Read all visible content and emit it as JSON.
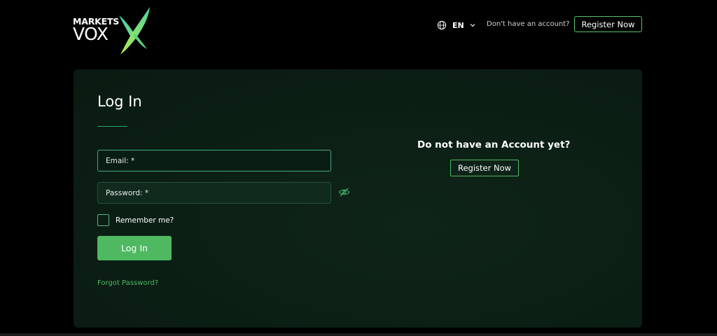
{
  "header": {
    "logo": {
      "line1": "MARKETS",
      "line2": "VOX"
    },
    "language": {
      "code": "EN",
      "icon": "globe-icon"
    },
    "no_account_text": "Don't have an account?",
    "register_label": "Register Now"
  },
  "login": {
    "title": "Log In",
    "email_placeholder": "Email: *",
    "password_placeholder": "Password: *",
    "remember_label": "Remember me?",
    "submit_label": "Log In",
    "forgot_label": "Forgot Password?"
  },
  "signup_panel": {
    "heading": "Do not have an Account yet?",
    "register_label": "Register Now"
  },
  "colors": {
    "accent": "#4fb961",
    "card_bg": "#0b1e14",
    "page_bg": "#000000"
  }
}
